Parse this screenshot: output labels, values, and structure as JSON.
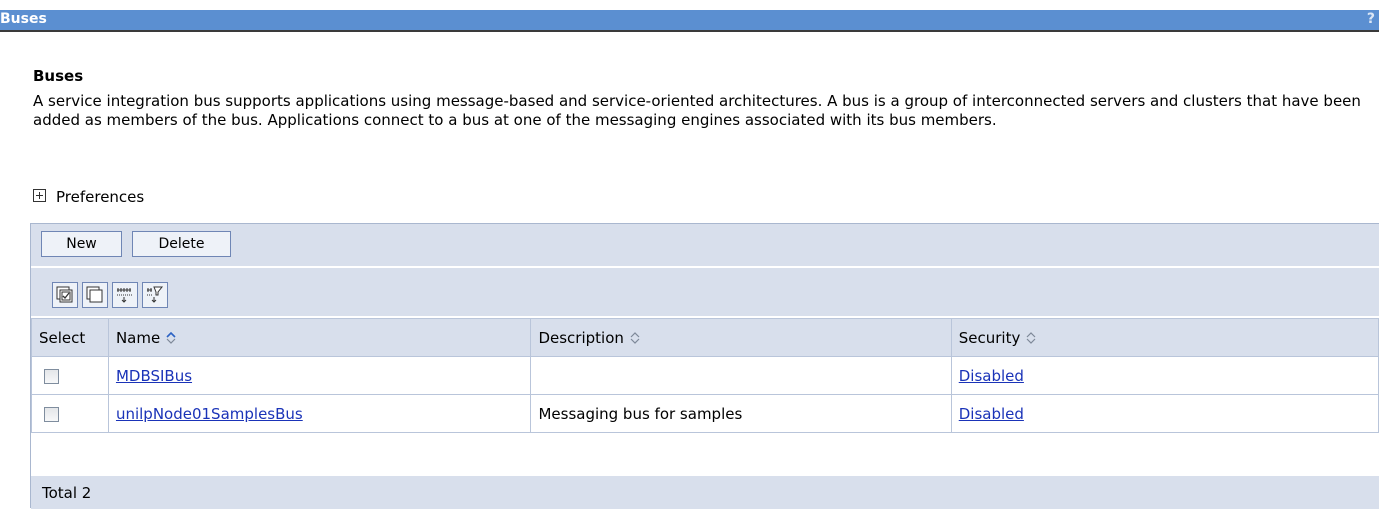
{
  "header": {
    "title": "Buses",
    "help": "?"
  },
  "page": {
    "heading": "Buses",
    "description": "A service integration bus supports applications using message-based and service-oriented architectures. A bus is a group of interconnected servers and clusters that have been added as members of the bus. Applications connect to a bus at one of the messaging engines associated with its bus members.",
    "preferences_label": "Preferences"
  },
  "toolbar": {
    "new_label": "New",
    "delete_label": "Delete"
  },
  "icons": [
    "select-all-icon",
    "deselect-all-icon",
    "show-filter-icon",
    "clear-filter-icon"
  ],
  "table": {
    "columns": [
      "Select",
      "Name",
      "Description",
      "Security"
    ],
    "rows": [
      {
        "name": "MDBSIBus",
        "description": "",
        "security": "Disabled",
        "selected": false
      },
      {
        "name": "unilpNode01SamplesBus",
        "description": "Messaging bus for samples",
        "security": "Disabled",
        "selected": false
      }
    ],
    "total": "Total 2"
  },
  "colors": {
    "title_bar": "#5b8fd1",
    "panel": "#d8dfec",
    "link": "#1a33b8"
  }
}
